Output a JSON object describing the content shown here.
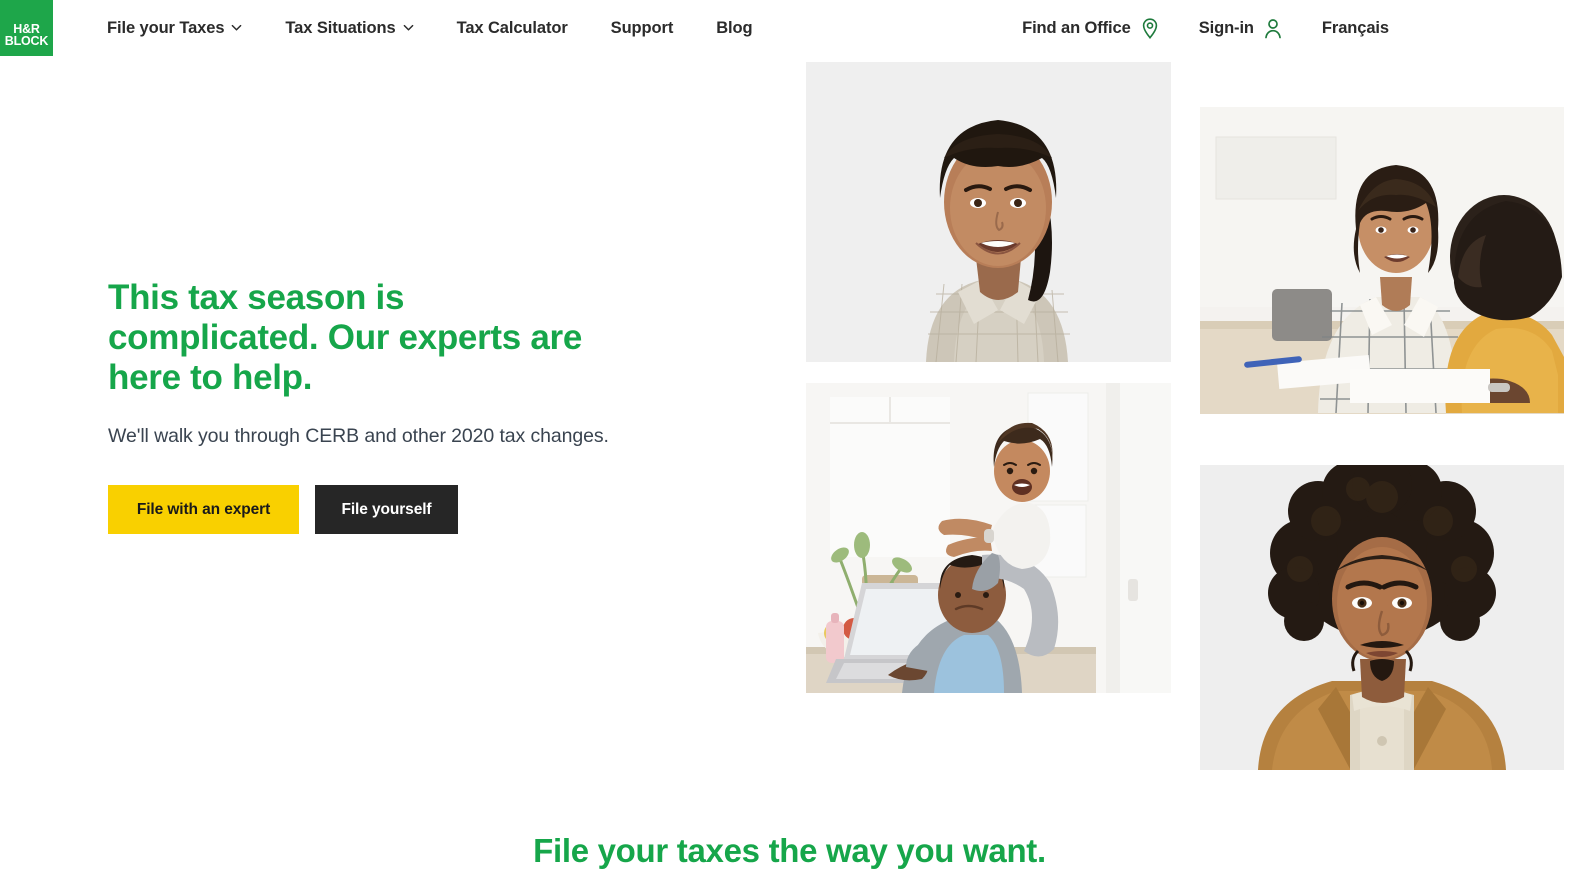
{
  "brand": {
    "logo_line1": "H&R",
    "logo_line2": "BLOCK",
    "green": "#16A64A",
    "yellow": "#F9D000",
    "dark": "#262626",
    "logo_icon": "hr-block-logo"
  },
  "header": {
    "nav_left": [
      {
        "label": "File your Taxes",
        "has_caret": true,
        "icon": "chevron-down-icon"
      },
      {
        "label": "Tax Situations",
        "has_caret": true,
        "icon": "chevron-down-icon"
      },
      {
        "label": "Tax Calculator",
        "has_caret": false
      },
      {
        "label": "Support",
        "has_caret": false
      },
      {
        "label": "Blog",
        "has_caret": false
      }
    ],
    "nav_right": [
      {
        "label": "Find an Office",
        "icon": "map-pin-icon"
      },
      {
        "label": "Sign-in",
        "icon": "user-account-icon"
      },
      {
        "label": "Français",
        "icon": null
      }
    ]
  },
  "hero": {
    "title_line1": "This tax season is",
    "title_line2": "complicated. Our experts are",
    "title_line3": "here to help.",
    "subtitle": "We'll walk you through CERB and other 2020 tax changes.",
    "primary_button": "File with an expert",
    "secondary_button": "File yourself"
  },
  "collage": {
    "photos": [
      {
        "alt": "Smiling woman in plaid shirt portrait",
        "name": "hero-photo-woman-portrait"
      },
      {
        "alt": "Tax expert meeting with a client across a desk",
        "name": "hero-photo-expert-meeting"
      },
      {
        "alt": "Father with toddler on shoulders using a laptop at home",
        "name": "hero-photo-father-laptop"
      },
      {
        "alt": "Man with afro in tan blazer portrait",
        "name": "hero-photo-man-portrait"
      }
    ]
  },
  "section": {
    "heading": "File your taxes the way you want."
  }
}
